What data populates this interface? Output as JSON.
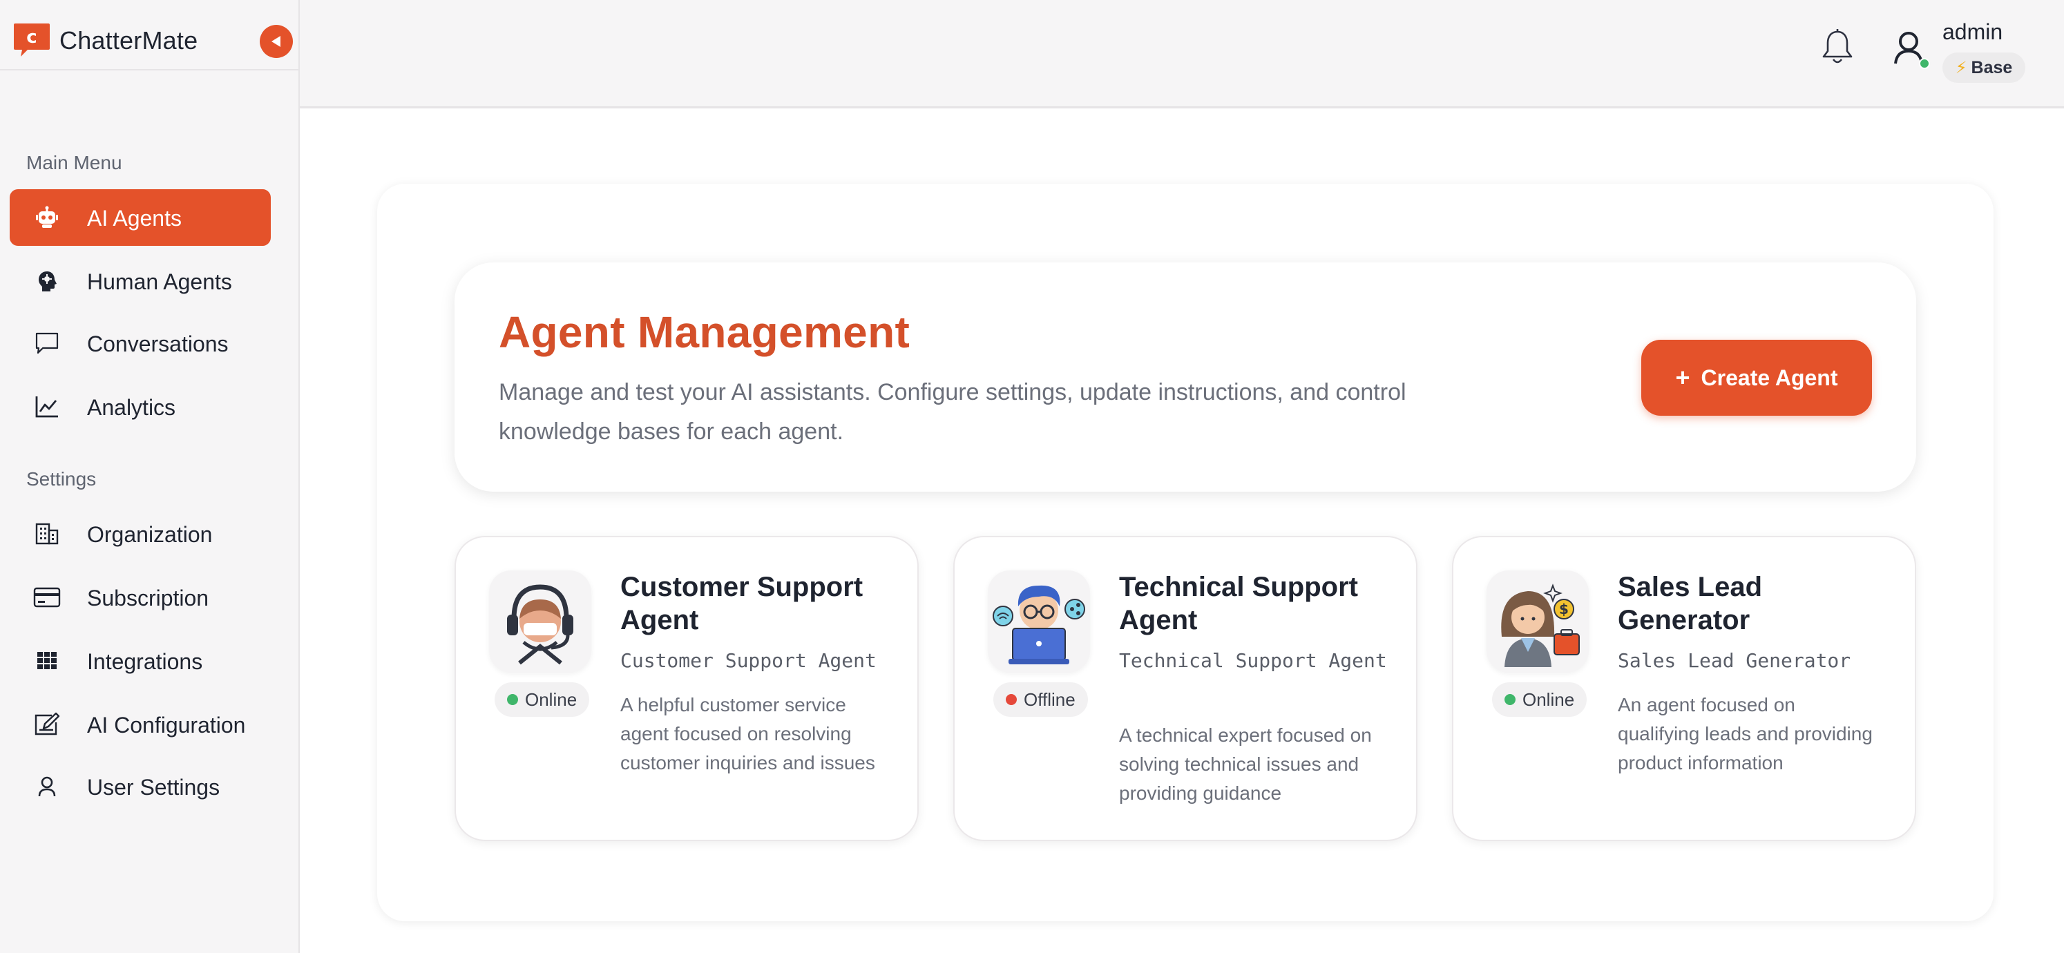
{
  "brand": {
    "name": "ChatterMate",
    "accent": "#e4522a"
  },
  "sidebar": {
    "sections": [
      {
        "label": "Main Menu"
      },
      {
        "label": "Settings"
      }
    ],
    "items": [
      {
        "label": "AI Agents",
        "icon": "robot-icon",
        "active": true
      },
      {
        "label": "Human Agents",
        "icon": "human-head-icon"
      },
      {
        "label": "Conversations",
        "icon": "chat-bubble-icon"
      },
      {
        "label": "Analytics",
        "icon": "line-chart-icon"
      },
      {
        "label": "Organization",
        "icon": "building-icon"
      },
      {
        "label": "Subscription",
        "icon": "credit-card-icon"
      },
      {
        "label": "Integrations",
        "icon": "grid-icon"
      },
      {
        "label": "AI Configuration",
        "icon": "edit-config-icon"
      },
      {
        "label": "User Settings",
        "icon": "user-icon"
      }
    ]
  },
  "header": {
    "user": {
      "name": "admin",
      "plan": "Base",
      "status_color": "#3fb66a"
    }
  },
  "main": {
    "title": "Agent Management",
    "description": "Manage and test your AI assistants. Configure settings, update instructions, and control knowledge bases for each agent.",
    "create_button": {
      "icon": "+",
      "label": "Create Agent"
    },
    "agents": [
      {
        "name": "Customer Support Agent",
        "display_name": "Customer Support Agent",
        "status": "Online",
        "status_color": "#3fb66a",
        "description": "A helpful customer service agent focused on resolving customer inquiries and issues",
        "avatar": "headset-agent-avatar"
      },
      {
        "name": "Technical Support Agent",
        "display_name": "Technical Support Agent",
        "status": "Offline",
        "status_color": "#e5483a",
        "description": "A technical expert focused on solving technical issues and providing guidance",
        "avatar": "tech-laptop-avatar"
      },
      {
        "name": "Sales Lead Generator",
        "display_name": "Sales Lead Generator",
        "status": "Online",
        "status_color": "#3fb66a",
        "description": "An agent focused on qualifying leads and providing product information",
        "avatar": "sales-woman-avatar"
      }
    ]
  }
}
